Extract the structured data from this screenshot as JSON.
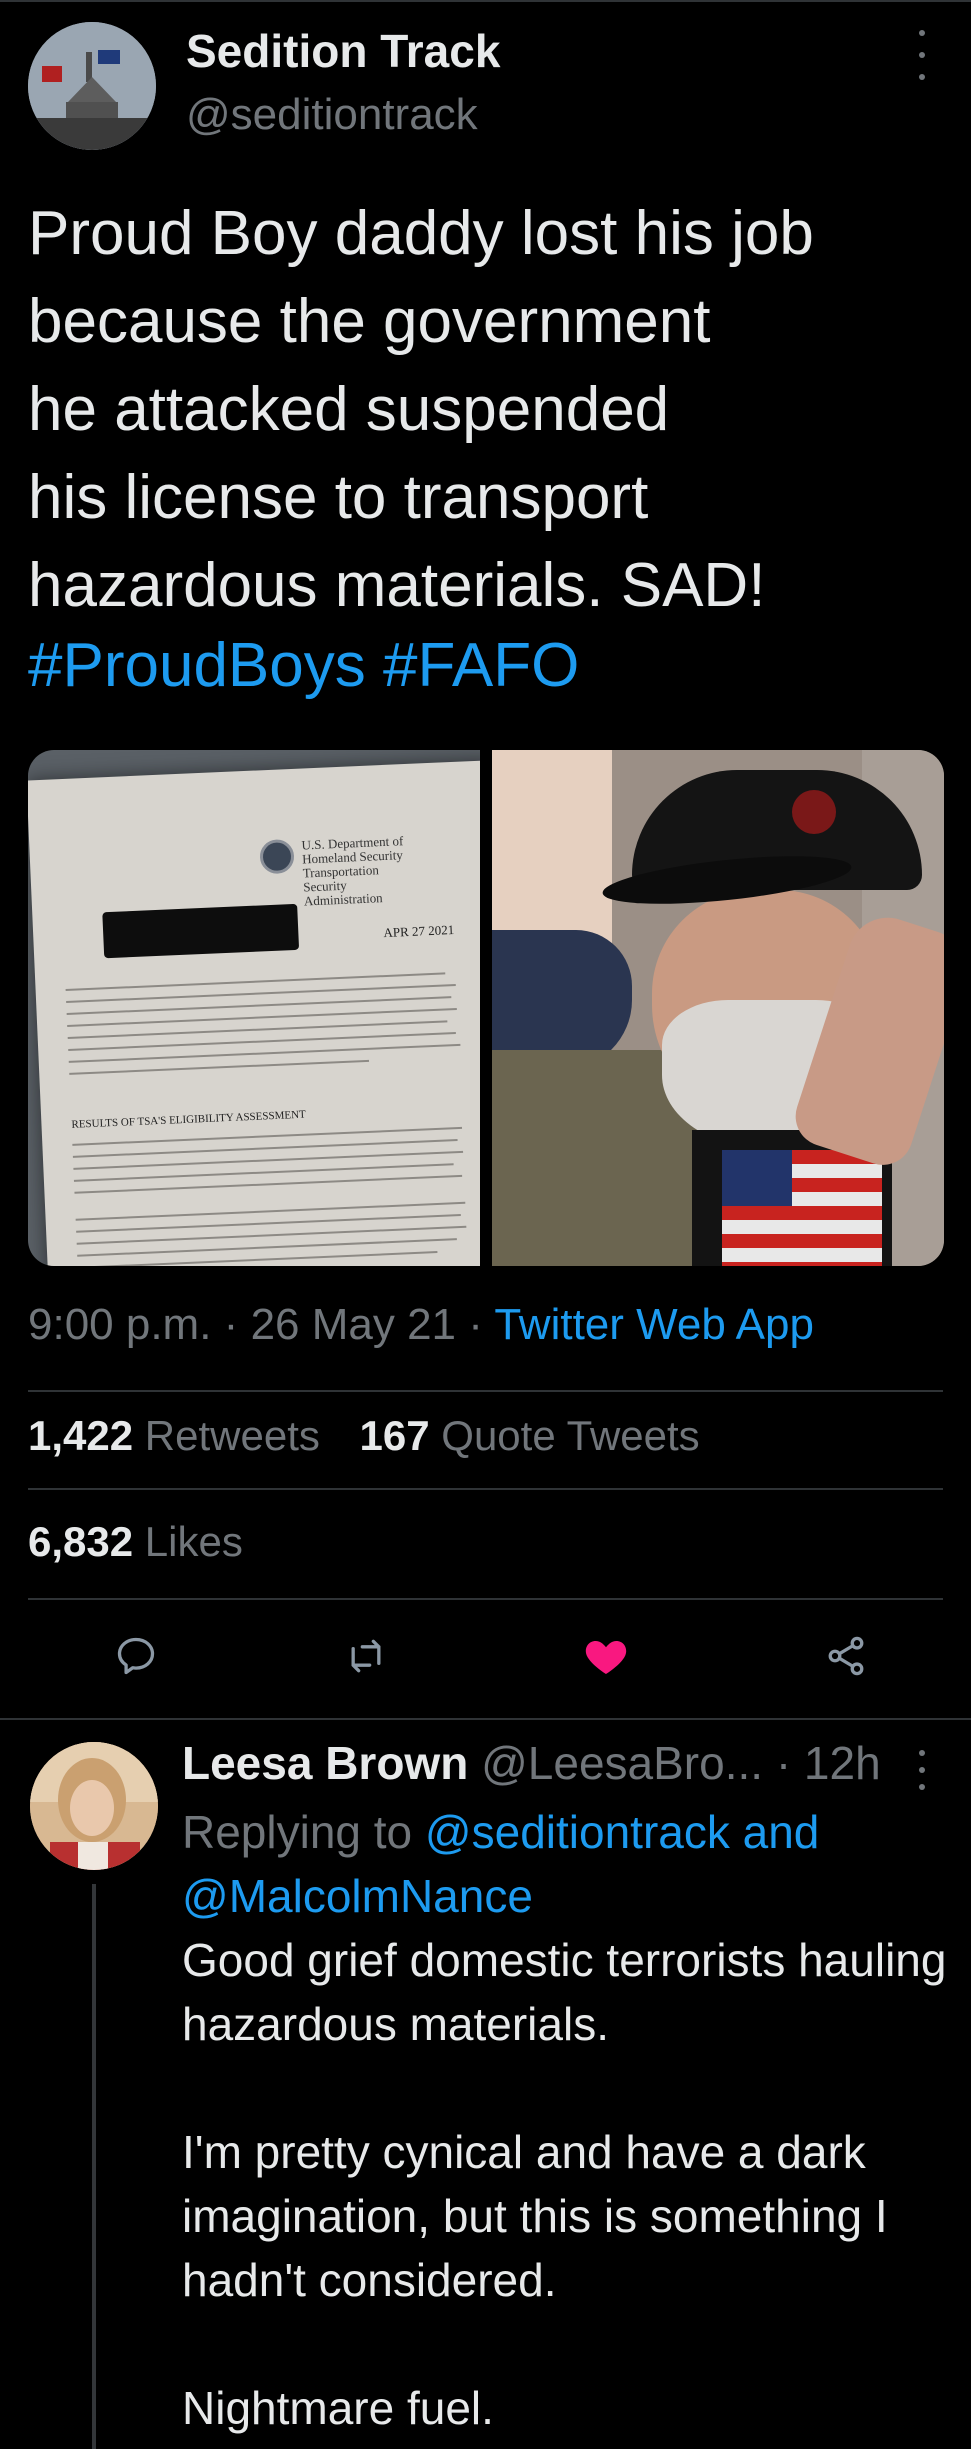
{
  "tweet": {
    "display_name": "Sedition Track",
    "handle": "@seditiontrack",
    "text": "Proud Boy daddy lost his job\nbecause the government\nhe attacked suspended\nhis license to transport\nhazardous materials. SAD!",
    "hashtags": "#ProudBoys #FAFO",
    "media": {
      "letter_org": "U.S. Department of Homeland Security\nTransportation\nSecurity\nAdministration",
      "letter_date": "APR 27 2021",
      "letter_heading": "RESULTS OF TSA'S ELIGIBILITY ASSESSMENT"
    },
    "time": "9:00 p.m.",
    "date": "26 May 21",
    "source": "Twitter Web App",
    "retweets_count": "1,422",
    "retweets_label": "Retweets",
    "quotes_count": "167",
    "quotes_label": "Quote Tweets",
    "likes_count": "6,832",
    "likes_label": "Likes"
  },
  "actions": {
    "reply_icon": "reply-icon",
    "retweet_icon": "retweet-icon",
    "like_icon": "heart-filled-icon",
    "share_icon": "share-icon",
    "like_color": "#f91880"
  },
  "reply": {
    "display_name": "Leesa Brown",
    "handle": "@LeesaBro...",
    "time": "· 12h",
    "replying_prefix": "Replying to",
    "mention_1": "@seditiontrack and",
    "mention_2": "@MalcolmNance",
    "paragraphs": [
      "Good grief domestic terrorists hauling hazardous materials.",
      "I'm pretty cynical and have a dark imagination, but this is something I hadn't considered.",
      "Nightmare fuel."
    ]
  },
  "colors": {
    "background": "#000000",
    "text": "#e7e9ea",
    "muted": "#71767b",
    "link": "#1d9bf0",
    "border": "#2f3336"
  }
}
